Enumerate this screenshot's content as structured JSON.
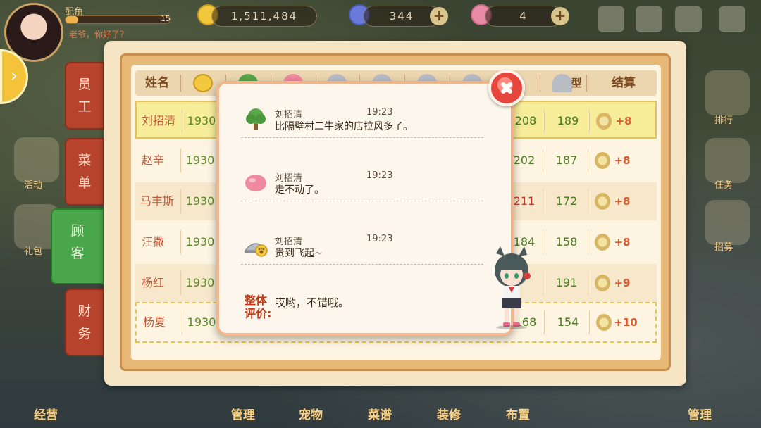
{
  "hud": {
    "player_name": "配角",
    "level": "15",
    "status": "老爷，你好了？",
    "gold": "1,511,484",
    "gems": "344",
    "hearts": "4",
    "plus": "+"
  },
  "side_menu": {
    "items": [
      "活动",
      "礼包",
      "经营"
    ],
    "right_items": [
      "排行",
      "任务",
      "招募",
      "管理"
    ]
  },
  "bottom_nav": [
    "经营",
    "管理",
    "宠物",
    "菜谱",
    "装修",
    "布置",
    "管理"
  ],
  "tabs": [
    {
      "line1": "员",
      "line2": "工"
    },
    {
      "line1": "菜",
      "line2": "单"
    },
    {
      "line1": "顾",
      "line2": "客"
    },
    {
      "line1": "财",
      "line2": "务"
    }
  ],
  "table": {
    "header_name": "姓名",
    "header_total": "结算",
    "header_dish_suffix": "型",
    "rows": [
      {
        "name": "刘招清",
        "col1": "1930",
        "col8": "208",
        "col9": "189",
        "total": "+8"
      },
      {
        "name": "赵辛",
        "col1": "1930",
        "col8": "202",
        "col9": "187",
        "total": "+8"
      },
      {
        "name": "马丰斯",
        "col1": "1930",
        "col8": "211",
        "col9": "172",
        "total": "+8"
      },
      {
        "name": "汪撒",
        "col1": "1930",
        "col8": "184",
        "col9": "158",
        "total": "+8"
      },
      {
        "name": "杨红",
        "col1": "1930",
        "col8": "",
        "col9": "191",
        "total": "+9"
      },
      {
        "name": "杨夏",
        "col1": "1930",
        "col8": "168",
        "col9": "154",
        "total": "+10"
      }
    ]
  },
  "popup": {
    "comments": [
      {
        "name": "刘招清",
        "time": "19:23",
        "text": "比隔壁村二牛家的店拉风多了。",
        "icon": "tree-icon"
      },
      {
        "name": "刘招清",
        "time": "19:23",
        "text": "走不动了。",
        "icon": "peach-icon"
      },
      {
        "name": "刘招清",
        "time": "19:23",
        "text": "贵到飞起~",
        "icon": "paw-dish-icon"
      }
    ],
    "overall_label_1": "整体",
    "overall_label_2": "评价:",
    "overall_text": "哎哟，不错哦。"
  }
}
